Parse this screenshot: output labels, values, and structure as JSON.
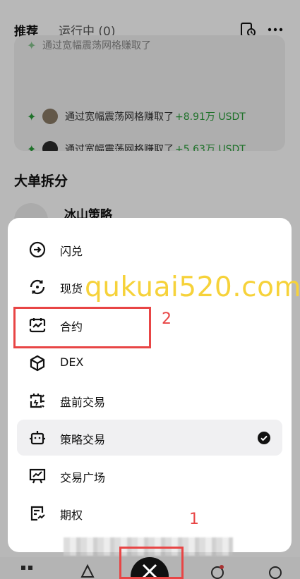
{
  "header": {
    "tabs": [
      {
        "label": "推荐",
        "active": true
      },
      {
        "label": "运行中 (0)",
        "active": false
      }
    ],
    "icons": [
      "history-icon",
      "more-icon"
    ]
  },
  "feed": {
    "rows": [
      {
        "prefix": "通过宽幅震荡网格赚取了",
        "amount": "+8.91万 USDT"
      },
      {
        "prefix": "通过宽幅震荡网格赚取了",
        "amount": "+5.63万 USDT"
      }
    ]
  },
  "section": {
    "title": "大单拆分",
    "strategy_name": "冰山策略"
  },
  "menu": {
    "items": [
      {
        "label": "闪兑",
        "icon": "flash-swap-icon",
        "selected": false
      },
      {
        "label": "现货",
        "icon": "spot-icon",
        "selected": false
      },
      {
        "label": "合约",
        "icon": "futures-icon",
        "selected": false
      },
      {
        "label": "DEX",
        "icon": "dex-cube-icon",
        "selected": false
      },
      {
        "label": "盘前交易",
        "icon": "pre-market-icon",
        "selected": false
      },
      {
        "label": "策略交易",
        "icon": "strategy-bot-icon",
        "selected": true
      },
      {
        "label": "交易广场",
        "icon": "trading-square-icon",
        "selected": false
      },
      {
        "label": "期权",
        "icon": "options-icon",
        "selected": false
      }
    ]
  },
  "overlay": {
    "watermark": "qukuai520.com",
    "annotation_1": "1",
    "annotation_2": "2"
  },
  "colors": {
    "accent_gain": "#2a9d3a",
    "annotation": "#e84545",
    "watermark": "#f6d23a"
  }
}
